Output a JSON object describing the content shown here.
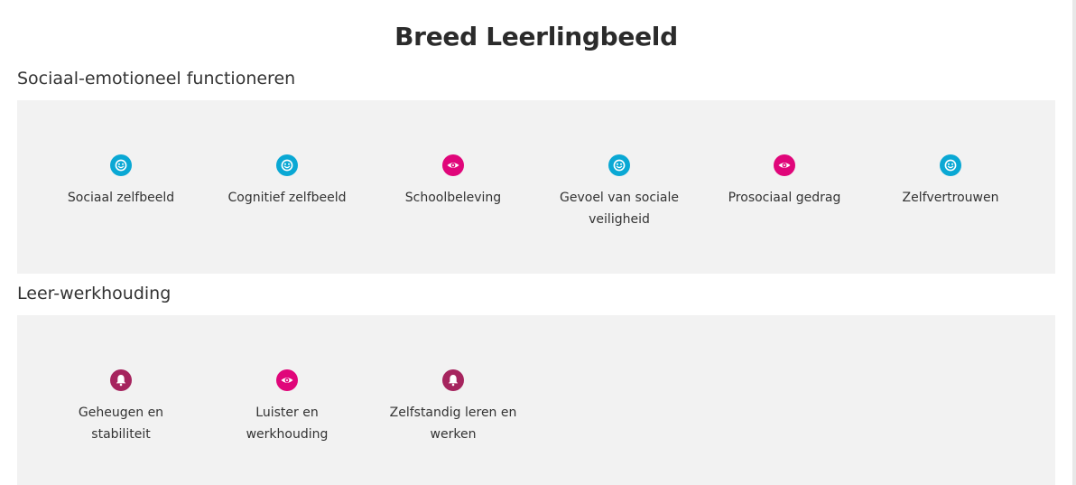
{
  "page": {
    "title": "Breed Leerlingbeeld"
  },
  "colors": {
    "smiley": "#0aa8d4",
    "eye": "#e0067a",
    "bell": "#a6245e",
    "panel": "#f2f2f2"
  },
  "sections": [
    {
      "title": "Sociaal-emotioneel functioneren",
      "items": [
        {
          "label": "Sociaal zelfbeeld",
          "icon": "smiley-icon"
        },
        {
          "label": "Cognitief zelfbeeld",
          "icon": "smiley-icon"
        },
        {
          "label": "Schoolbeleving",
          "icon": "eye-icon"
        },
        {
          "label": "Gevoel van sociale veiligheid",
          "icon": "smiley-icon"
        },
        {
          "label": "Prosociaal gedrag",
          "icon": "eye-icon"
        },
        {
          "label": "Zelfvertrouwen",
          "icon": "smiley-icon"
        }
      ]
    },
    {
      "title": "Leer-werkhouding",
      "items": [
        {
          "label": "Geheugen en stabiliteit",
          "icon": "bell-icon"
        },
        {
          "label": "Luister en werkhouding",
          "icon": "eye-icon"
        },
        {
          "label": "Zelfstandig leren en werken",
          "icon": "bell-icon"
        }
      ]
    }
  ]
}
